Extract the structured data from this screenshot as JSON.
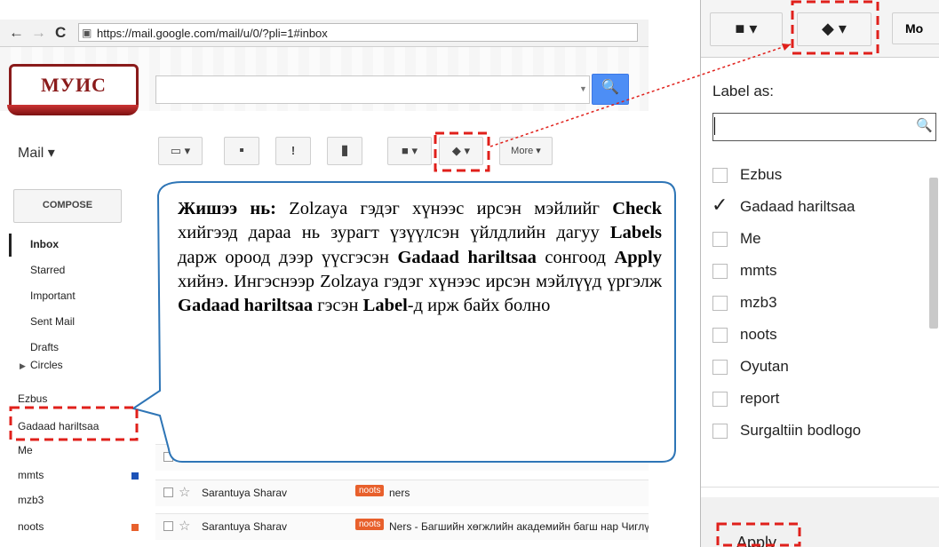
{
  "browser": {
    "back": "←",
    "forward": "→",
    "reload": "C",
    "url": "https://mail.google.com/mail/u/0/?pli=1#inbox"
  },
  "logo": {
    "text": "МУИС"
  },
  "gmail": {
    "search_button": "🔍",
    "mail_label": "Mail ▾",
    "toolbar": {
      "select": "▭ ▾",
      "archive": "▪",
      "spam": "!",
      "delete": "▮",
      "move": "■ ▾",
      "labels": "◆ ▾",
      "more": "More ▾"
    },
    "compose": "COMPOSE",
    "nav": [
      "Inbox",
      "Starred",
      "Important",
      "Sent Mail",
      "Drafts",
      "Circles"
    ],
    "labels": [
      "Ezbus",
      "Gadaad hariltsaa",
      "Me",
      "mmts",
      "mzb3",
      "noots"
    ],
    "label_colors": {
      "mmts": "#1c52b8",
      "noots": "#e8602c"
    },
    "rows": [
      {
        "sender": "Sarantuya Sharav",
        "badge": "noots",
        "subject": "ners"
      },
      {
        "sender": "Sarantuya Sharav",
        "badge": "noots",
        "subject": "Ners - Багшийн хөгжлийн академийн багш нар Чиглүүлэгч"
      }
    ]
  },
  "callout": {
    "lead": "Жишээ нь:",
    "t1": " Zolzaya гэдэг хүнээс ирсэн мэйлийг ",
    "b1": "Check",
    "t2": " хийгээд дараа нь зурагт үзүүлсэн үйлдлийн дагуу ",
    "b2": "Labels",
    "t3": " дарж ороод дээр үүсгэсэн ",
    "b3": "Gadaad hariltsaa",
    "t4": " сонгоод ",
    "b4": "Apply",
    "t5": " хийнэ. Ингэснээр Zolzaya гэдэг хүнээс ирсэн мэйлүүд үргэлж ",
    "b5": "Gadaad hariltsaa",
    "t6": " гэсэн ",
    "b6": "Label",
    "t7": "-д ирж байх болно"
  },
  "label_panel": {
    "folder_btn": "■ ▾",
    "label_btn": "◆ ▾",
    "more_btn": "Mo",
    "title": "Label as:",
    "search_icon": "🔍",
    "items": [
      {
        "name": "Ezbus",
        "checked": false
      },
      {
        "name": "Gadaad hariltsaa",
        "checked": true
      },
      {
        "name": "Me",
        "checked": false
      },
      {
        "name": "mmts",
        "checked": false
      },
      {
        "name": "mzb3",
        "checked": false
      },
      {
        "name": "noots",
        "checked": false
      },
      {
        "name": "Oyutan",
        "checked": false
      },
      {
        "name": "report",
        "checked": false
      },
      {
        "name": "Surgaltiin bodlogo",
        "checked": false
      }
    ],
    "checkmark": "✓",
    "apply": "Apply"
  },
  "colors": {
    "highlight": "#e0201b",
    "search_blue": "#4d8ef5",
    "callout_border": "#2e75b6",
    "logo": "#8a1b1b"
  }
}
